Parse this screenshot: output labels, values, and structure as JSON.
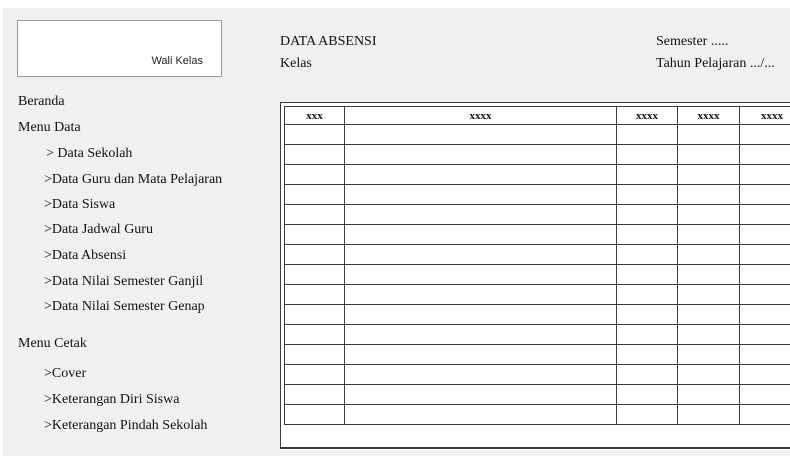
{
  "wali_kelas": "Wali Kelas",
  "header": {
    "title": "DATA ABSENSI",
    "kelas": "Kelas",
    "semester": "Semester .....",
    "tahun": "Tahun Pelajaran .../..."
  },
  "menu": {
    "beranda": "Beranda",
    "menu_data": "Menu Data",
    "data_items": [
      "> Data Sekolah",
      ">Data Guru dan Mata Pelajaran",
      ">Data Siswa",
      ">Data Jadwal Guru",
      ">Data Absensi",
      ">Data Nilai Semester Ganjil",
      ">Data Nilai Semester Genap"
    ],
    "menu_cetak": "Menu Cetak",
    "cetak_items": [
      ">Cover",
      ">Keterangan Diri Siswa",
      ">Keterangan Pindah Sekolah"
    ]
  },
  "table": {
    "headers": [
      "xxx",
      "xxxx",
      "xxxx",
      "xxxx",
      "xxxx"
    ],
    "empty_rows": 15
  }
}
